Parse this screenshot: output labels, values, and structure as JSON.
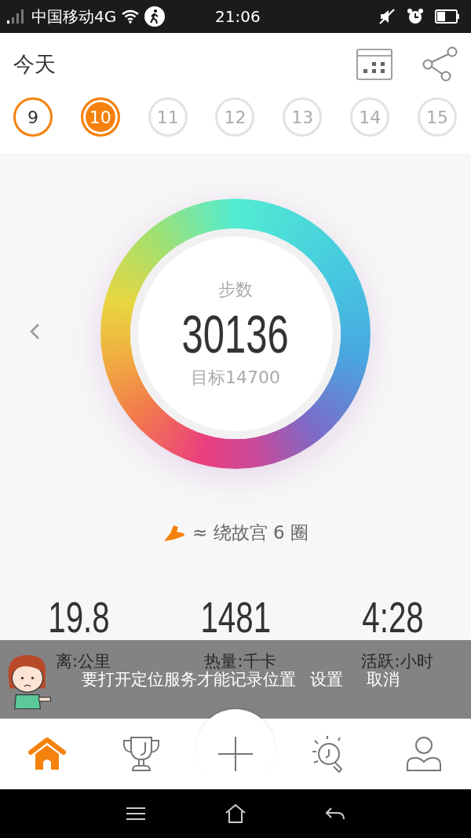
{
  "status_bar": {
    "carrier": "中国移动4G",
    "time": "21:06"
  },
  "header": {
    "title": "今天"
  },
  "days": [
    {
      "label": "9",
      "selected": false,
      "disabled": false
    },
    {
      "label": "10",
      "selected": true,
      "disabled": false
    },
    {
      "label": "11",
      "selected": false,
      "disabled": true
    },
    {
      "label": "12",
      "selected": false,
      "disabled": true
    },
    {
      "label": "13",
      "selected": false,
      "disabled": true
    },
    {
      "label": "14",
      "selected": false,
      "disabled": true
    },
    {
      "label": "15",
      "selected": false,
      "disabled": true
    }
  ],
  "ring": {
    "label": "步数",
    "value": "30136",
    "goal": "目标14700"
  },
  "comparison": "≈ 绕故宫 6 圈",
  "stats": [
    {
      "value": "19.8",
      "label": "离:公里"
    },
    {
      "value": "1481",
      "label": "热量:千卡"
    },
    {
      "value": "4:28",
      "label": "活跃:小时"
    }
  ],
  "toast": {
    "message": "要打开定位服务才能记录位置",
    "actions": [
      "设置",
      "取消"
    ]
  },
  "nav": [
    {
      "kind": "home",
      "selected": true
    },
    {
      "kind": "trophy",
      "selected": false
    },
    {
      "kind": "add",
      "selected": false
    },
    {
      "kind": "idea",
      "selected": false
    },
    {
      "kind": "profile",
      "selected": false
    }
  ]
}
